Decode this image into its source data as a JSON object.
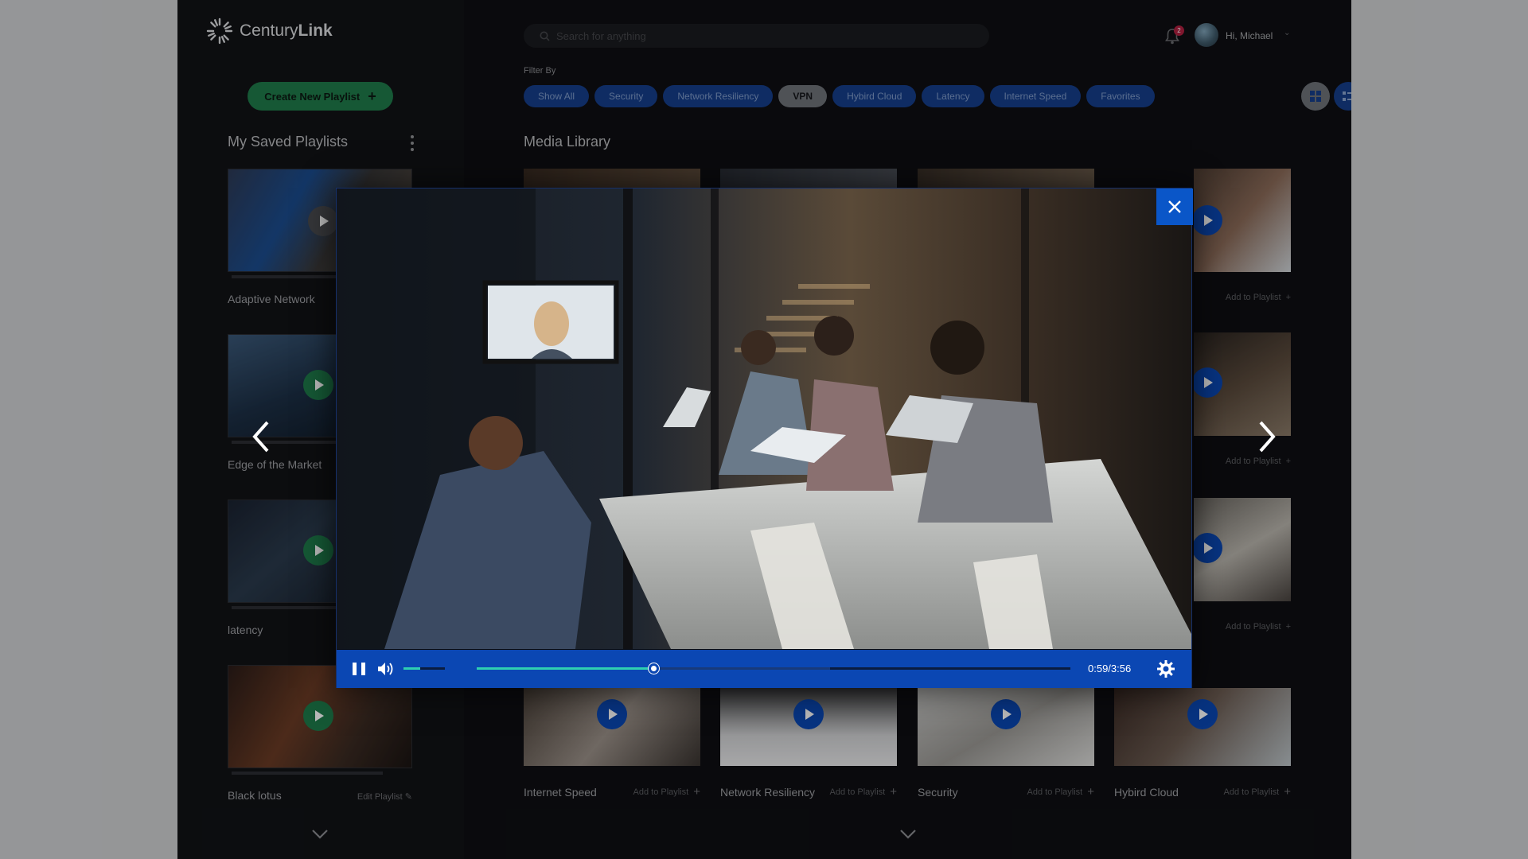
{
  "brand": {
    "name_regular": "Century",
    "name_bold": "Link"
  },
  "sidebar": {
    "create_button": "Create New Playlist",
    "saved_title": "My Saved Playlists",
    "playlists": [
      {
        "label": "Adaptive Network"
      },
      {
        "label": "Edge of the Market"
      },
      {
        "label": "latency"
      },
      {
        "label": "Black lotus",
        "edit_label": "Edit Playlist"
      }
    ]
  },
  "header": {
    "search_placeholder": "Search for anything",
    "notification_count": "2",
    "greeting": "Hi, Michael"
  },
  "filters": {
    "label": "Filter By",
    "chips": [
      "Show All",
      "Security",
      "Network Resiliency",
      "VPN",
      "Hybird Cloud",
      "Latency",
      "Internet Speed",
      "Favorites"
    ],
    "active": "VPN"
  },
  "library": {
    "title": "Media Library",
    "add_label": "Add to Playlist",
    "bottom_cards": [
      {
        "name": "Internet Speed"
      },
      {
        "name": "Network Resiliency"
      },
      {
        "name": "Security"
      },
      {
        "name": "Hybird Cloud"
      }
    ]
  },
  "player": {
    "time": "0:59/3:56",
    "progress": 0.299,
    "buffered": 0.595,
    "volume": 0.4
  },
  "colors": {
    "accent_blue": "#0b47b3",
    "progress": "#2ecfb1",
    "brand_green": "#1f7a4a"
  }
}
